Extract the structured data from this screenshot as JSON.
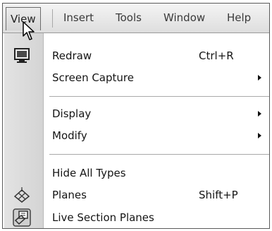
{
  "menubar": {
    "items": [
      {
        "label": "View",
        "active": true
      },
      {
        "label": "Insert",
        "active": false
      },
      {
        "label": "Tools",
        "active": false
      },
      {
        "label": "Window",
        "active": false
      },
      {
        "label": "Help",
        "active": false
      }
    ]
  },
  "dropdown": {
    "items": [
      {
        "label": "Redraw",
        "shortcut": "Ctrl+R",
        "icon": "redraw-monitor-icon"
      },
      {
        "label": "Screen Capture",
        "submenu": true
      },
      {
        "label": "Display",
        "submenu": true
      },
      {
        "label": "Modify",
        "submenu": true
      },
      {
        "label": "Hide All Types"
      },
      {
        "label": "Planes",
        "shortcut": "Shift+P",
        "icon": "planes-icon"
      },
      {
        "label": "Live Section Planes",
        "icon": "live-section-planes-icon"
      }
    ]
  },
  "colors": {
    "menubar_bg": "#e6e6e6",
    "icon_strip_bg": "#dcdcdc",
    "text": "#151515",
    "divider": "#a9a9a9"
  }
}
